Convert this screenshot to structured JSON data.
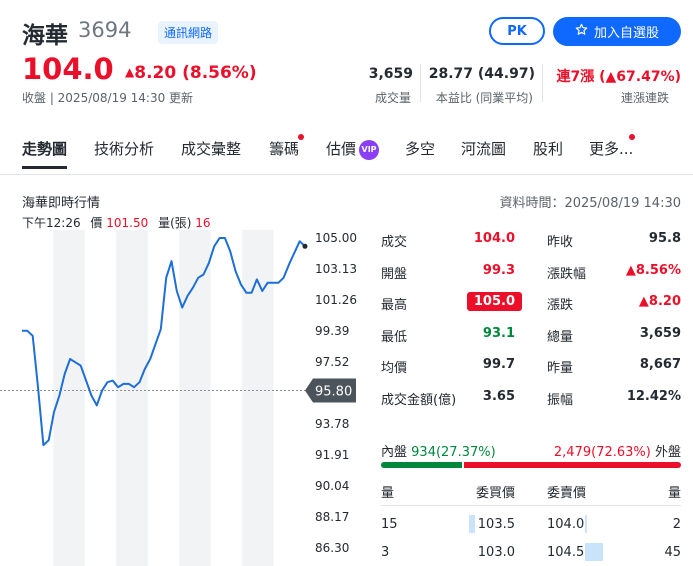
{
  "stock": {
    "name": "海華",
    "code": "3694",
    "industry_tag": "通訊網路"
  },
  "buttons": {
    "pk": "PK",
    "watchlist": "加入自選股"
  },
  "quote": {
    "price": "104.0",
    "change": "8.20 (8.56%)",
    "time_label": "收盤 | 2025/08/19 14:30 更新"
  },
  "stats": [
    {
      "value": "3,659",
      "label": "成交量"
    },
    {
      "value": "28.77 (44.97)",
      "label": "本益比 (同業平均)"
    },
    {
      "value": "連7漲 (▲67.47%)",
      "label": "連漲連跌"
    }
  ],
  "tabs": [
    {
      "label": "走勢圖",
      "active": true,
      "dot": false
    },
    {
      "label": "技術分析",
      "active": false,
      "dot": false
    },
    {
      "label": "成交彙整",
      "active": false,
      "dot": false
    },
    {
      "label": "籌碼",
      "active": false,
      "dot": true
    },
    {
      "label": "估價",
      "active": false,
      "dot": false,
      "badge": "VIP"
    },
    {
      "label": "多空",
      "active": false,
      "dot": false
    },
    {
      "label": "河流圖",
      "active": false,
      "dot": false
    },
    {
      "label": "股利",
      "active": false,
      "dot": false
    },
    {
      "label": "更多...",
      "active": false,
      "dot": true
    }
  ],
  "realtime": {
    "title": "海華即時行情",
    "data_time": "資料時間：2025/08/19 14:30",
    "cursor_time": "下午12:26",
    "cursor_price_label": "價",
    "cursor_price": "101.50",
    "cursor_volume_label": "量(張)",
    "cursor_volume": "16"
  },
  "chart_data": {
    "type": "line",
    "y_ticks": [
      "105.00",
      "103.13",
      "101.26",
      "99.39",
      "97.52",
      "95.80",
      "93.78",
      "91.91",
      "90.04",
      "88.17",
      "86.30"
    ],
    "reference_price": 95.8,
    "ylim": [
      86.3,
      105.0
    ],
    "x_session": [
      "09:00",
      "13:30"
    ],
    "y": [
      99.4,
      99.4,
      99.1,
      96.0,
      92.5,
      92.8,
      94.5,
      95.5,
      96.8,
      97.7,
      97.5,
      97.3,
      96.4,
      95.5,
      94.9,
      95.8,
      96.3,
      96.4,
      96.0,
      96.2,
      96.2,
      96.0,
      96.3,
      97.1,
      97.7,
      98.6,
      99.5,
      102.6,
      103.6,
      101.8,
      100.8,
      101.5,
      102.0,
      102.6,
      102.8,
      103.5,
      104.5,
      105.0,
      105.0,
      104.2,
      103.0,
      102.2,
      101.7,
      101.7,
      102.5,
      101.8,
      102.3,
      102.3,
      102.3,
      102.6,
      103.4,
      104.1,
      104.8,
      104.5
    ],
    "grid": "alternating vertical bands"
  },
  "quote_table": [
    {
      "l1": "成交",
      "v1": "104.0",
      "c1": "up",
      "l2": "昨收",
      "v2": "95.8",
      "c2": "neutral"
    },
    {
      "l1": "開盤",
      "v1": "99.3",
      "c1": "up",
      "l2": "漲跌幅",
      "v2": "▲8.56%",
      "c2": "up"
    },
    {
      "l1": "最高",
      "v1": "105.0",
      "c1": "limit",
      "l2": "漲跌",
      "v2": "▲8.20",
      "c2": "up"
    },
    {
      "l1": "最低",
      "v1": "93.1",
      "c1": "down",
      "l2": "總量",
      "v2": "3,659",
      "c2": "neutral"
    },
    {
      "l1": "均價",
      "v1": "99.7",
      "c1": "neutral",
      "l2": "昨量",
      "v2": "8,667",
      "c2": "neutral"
    },
    {
      "l1": "成交金額(億)",
      "v1": "3.65",
      "c1": "neutral",
      "l2": "振幅",
      "v2": "12.42%",
      "c2": "neutral"
    }
  ],
  "inner_outer": {
    "inner_label": "內盤",
    "inner_value": "934(27.37%)",
    "outer_value": "2,479(72.63%)",
    "outer_label": "外盤",
    "inner_pct": 27.37
  },
  "order_book": {
    "headers": [
      "量",
      "委買價",
      "委賣價",
      "量"
    ],
    "rows": [
      {
        "bid_vol": "15",
        "bid": "103.5",
        "ask": "104.0",
        "ask_vol": "2"
      },
      {
        "bid_vol": "3",
        "bid": "103.0",
        "ask": "104.5",
        "ask_vol": "45"
      }
    ]
  },
  "colors": {
    "up": "#eb0f29",
    "down": "#00873c",
    "accent": "#0f69ff",
    "line": "#1d6fd6",
    "limit_bg": "#eb0f29"
  }
}
